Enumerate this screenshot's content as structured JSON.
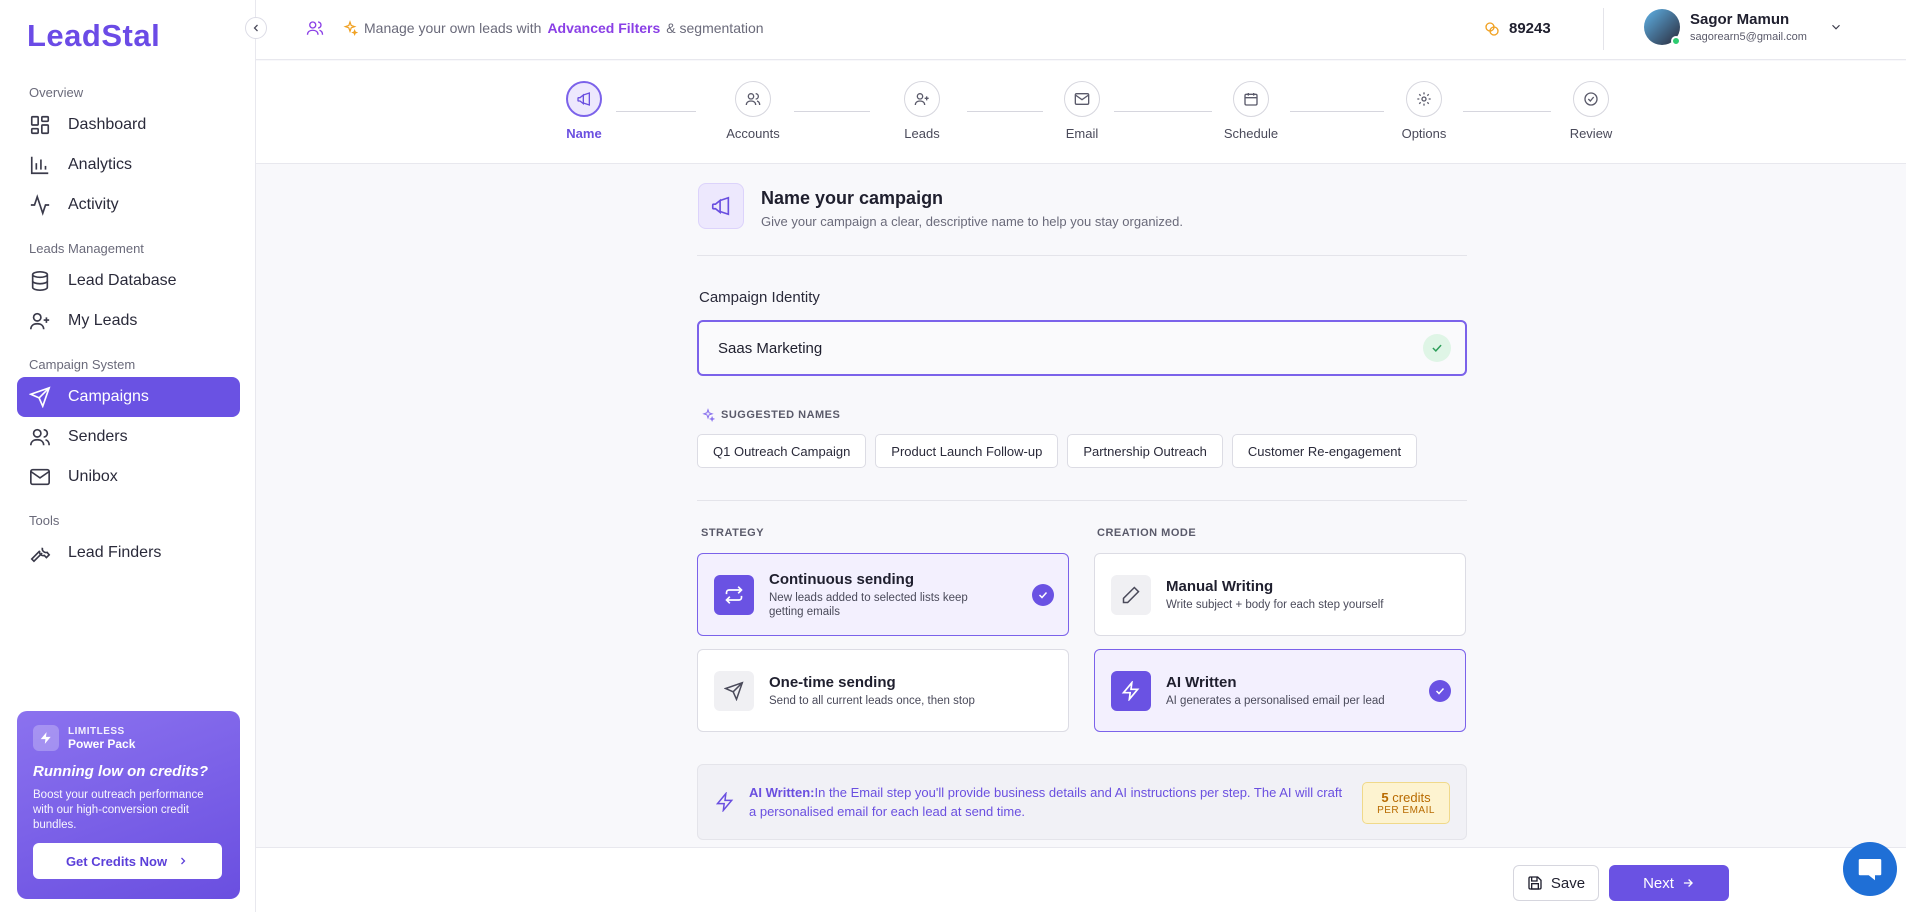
{
  "app": {
    "logo": "LeadStal"
  },
  "sidebar": {
    "sections": [
      {
        "label": "Overview"
      },
      {
        "label": "Leads Management"
      },
      {
        "label": "Campaign System"
      },
      {
        "label": "Tools"
      }
    ],
    "items": [
      {
        "label": "Dashboard",
        "icon": "dashboard-icon"
      },
      {
        "label": "Analytics",
        "icon": "bar-chart-icon"
      },
      {
        "label": "Activity",
        "icon": "activity-icon"
      },
      {
        "label": "Lead Database",
        "icon": "database-icon"
      },
      {
        "label": "My Leads",
        "icon": "user-plus-icon"
      },
      {
        "label": "Campaigns",
        "icon": "send-icon",
        "active": true
      },
      {
        "label": "Senders",
        "icon": "users-icon"
      },
      {
        "label": "Unibox",
        "icon": "mail-icon"
      },
      {
        "label": "Lead Finders",
        "icon": "wrench-icon"
      }
    ],
    "promo": {
      "small": "LIMITLESS",
      "name": "Power Pack",
      "title": "Running low on credits?",
      "desc": "Boost your outreach performance with our high-conversion credit bundles.",
      "button": "Get Credits Now"
    }
  },
  "topbar": {
    "banner_prefix": "Manage your own leads with",
    "banner_highlight": "Advanced Filters",
    "banner_suffix": "& segmentation",
    "credits": "89243",
    "user_name": "Sagor Mamun",
    "user_email": "sagorearn5@gmail.com"
  },
  "steps": [
    {
      "label": "Name",
      "icon": "megaphone-icon",
      "active": true
    },
    {
      "label": "Accounts",
      "icon": "users-icon"
    },
    {
      "label": "Leads",
      "icon": "user-plus-icon"
    },
    {
      "label": "Email",
      "icon": "mail-icon"
    },
    {
      "label": "Schedule",
      "icon": "calendar-icon"
    },
    {
      "label": "Options",
      "icon": "gear-icon"
    },
    {
      "label": "Review",
      "icon": "check-circle-icon"
    }
  ],
  "header": {
    "title": "Name your campaign",
    "subtitle": "Give your campaign a clear, descriptive name to help you stay organized."
  },
  "identity": {
    "label": "Campaign Identity",
    "value": "Saas Marketing"
  },
  "suggested": {
    "label": "SUGGESTED NAMES",
    "names": [
      "Q1 Outreach Campaign",
      "Product Launch Follow-up",
      "Partnership Outreach",
      "Customer Re-engagement"
    ]
  },
  "strategy": {
    "label": "STRATEGY",
    "options": [
      {
        "title": "Continuous sending",
        "desc": "New leads added to selected lists keep getting emails",
        "selected": true
      },
      {
        "title": "One-time sending",
        "desc": "Send to all current leads once, then stop",
        "selected": false
      }
    ]
  },
  "mode": {
    "label": "CREATION MODE",
    "options": [
      {
        "title": "Manual Writing",
        "desc": "Write subject + body for each step yourself",
        "selected": false
      },
      {
        "title": "AI Written",
        "desc": "AI generates a personalised email per lead",
        "selected": true
      }
    ]
  },
  "info": {
    "bold": "AI Written:",
    "text": "In the Email step you'll provide business details and AI instructions per step. The AI will craft a personalised email for each lead at send time.",
    "cost_amount": "5",
    "cost_unit": "credits",
    "cost_sub": "PER EMAIL"
  },
  "footer": {
    "save": "Save",
    "next": "Next"
  },
  "colors": {
    "accent": "#6a52e3",
    "highlight": "#8a3fe6",
    "success": "#2ecc71"
  }
}
